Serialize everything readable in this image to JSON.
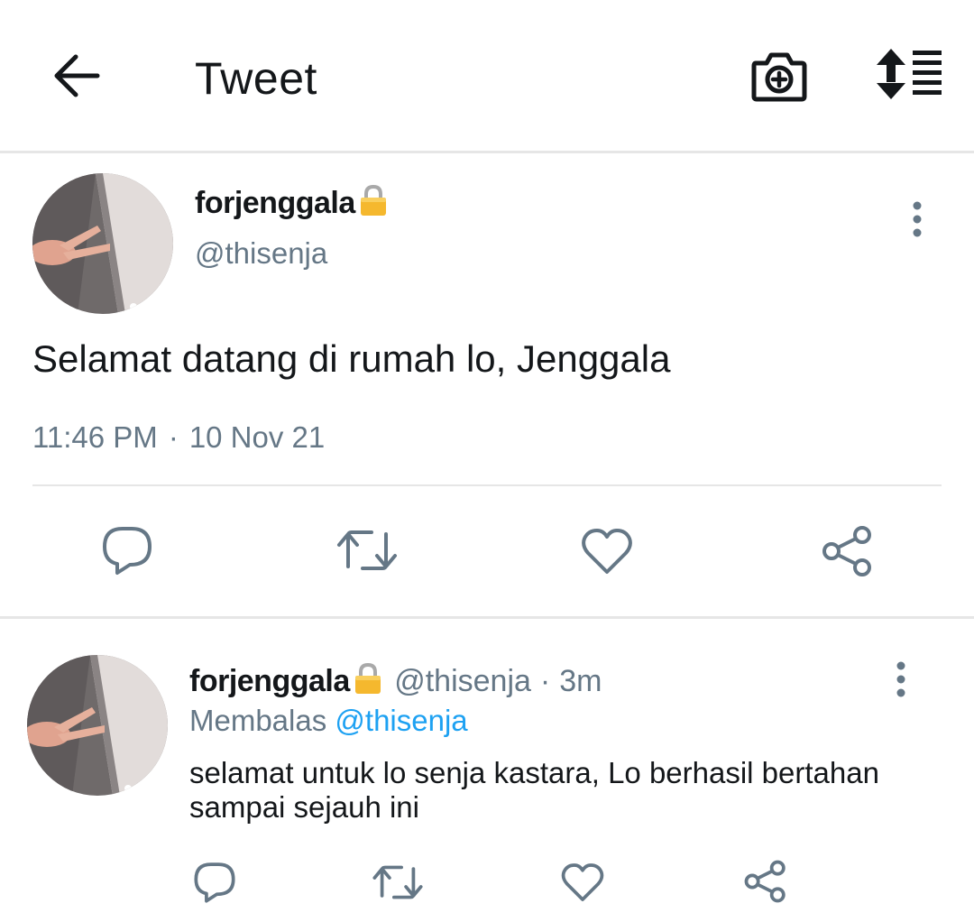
{
  "header": {
    "title": "Tweet",
    "back_icon": "arrow-left-icon",
    "camera_icon": "camera-plus-icon",
    "sort_icon": "sort-list-icon"
  },
  "tweet": {
    "display_name": "forjenggala",
    "handle": "@thisenja",
    "text": "Selamat datang di rumah lo, Jenggala",
    "time": "11:46 PM",
    "separator": "·",
    "date": "10 Nov 21",
    "protected_icon": "lock-icon",
    "more_icon": "more-vertical-icon"
  },
  "actions": {
    "reply_icon": "reply-icon",
    "retweet_icon": "retweet-icon",
    "like_icon": "heart-icon",
    "share_icon": "share-icon"
  },
  "reply": {
    "display_name": "forjenggala",
    "handle": "@thisenja",
    "separator": "·",
    "time": "3m",
    "replying_prefix": "Membalas",
    "replying_to": "@thisenja",
    "text": "selamat untuk lo senja kastara, Lo berhasil bertahan sampai sejauh ini"
  },
  "colors": {
    "text_primary": "#14171a",
    "text_secondary": "#657786",
    "accent": "#1da1f2",
    "divider": "#e6e6e6",
    "lock": "#f5b82e"
  }
}
